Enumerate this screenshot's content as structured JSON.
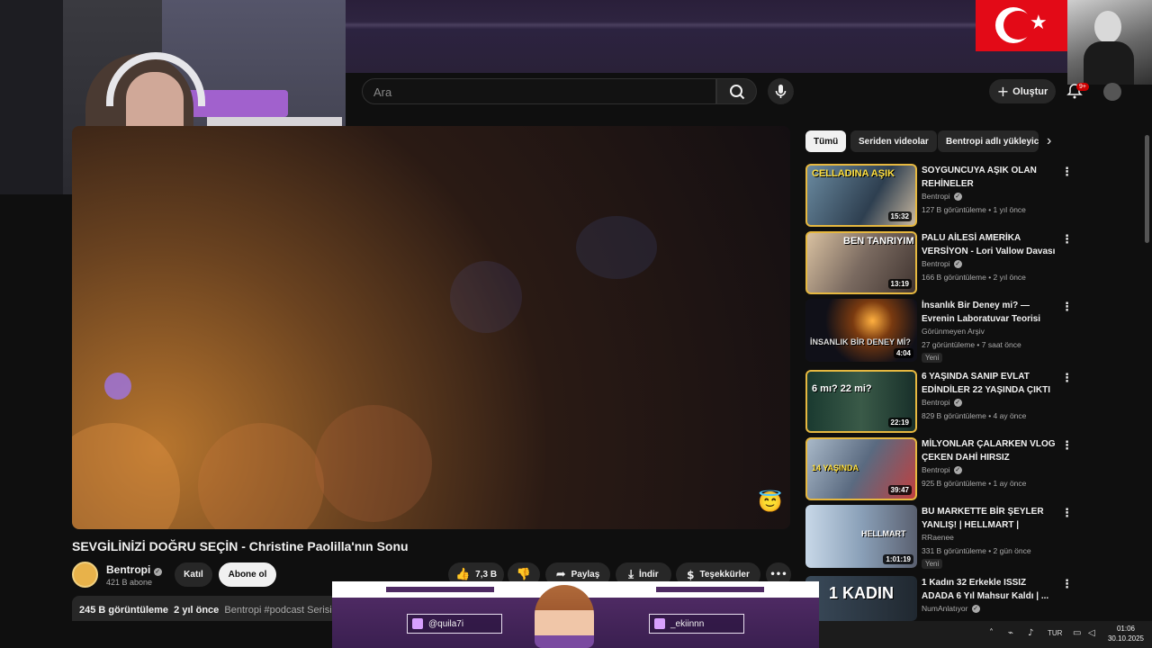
{
  "header": {
    "search_placeholder": "Ara",
    "create_label": "Oluştur",
    "notif_count": "9+"
  },
  "video": {
    "title": "SEVGİLİNİZİ DOĞRU SEÇİN - Christine Paolilla'nın Sonu",
    "channel": "Bentropi",
    "subs": "421 B abone",
    "join_label": "Katıl",
    "subscribe_label": "Abone ol",
    "likes": "7,3 B",
    "share_label": "Paylaş",
    "download_label": "İndir",
    "thanks_label": "Teşekkürler",
    "views": "245 B görüntüleme",
    "age": "2 yıl önce",
    "desc_channel": "Bentropi",
    "hashtag": "#podcast Serisi"
  },
  "chips": [
    "Tümü",
    "Seriden videolar",
    "Bentropi adlı yükleyici"
  ],
  "recs": [
    {
      "title": "SOYGUNCUYA AŞIK OLAN REHİNELER",
      "channel": "Bentropi",
      "meta": "127 B görüntüleme • 1 yıl önce",
      "duration": "15:32",
      "thumb_text": "CELLADINA AŞIK",
      "badge": ""
    },
    {
      "title": "PALU AİLESİ AMERİKA VERSİYON - Lori Vallow Davası",
      "channel": "Bentropi",
      "meta": "166 B görüntüleme • 2 yıl önce",
      "duration": "13:19",
      "thumb_text": "BEN TANRIYIM",
      "badge": ""
    },
    {
      "title": "İnsanlık Bir Deney mi? — Evrenin Laboratuvar Teorisi",
      "channel": "Görünmeyen Arşiv",
      "meta": "27 görüntüleme • 7 saat önce",
      "duration": "4:04",
      "thumb_text": "İNSANLIK BİR DENEY Mİ?",
      "badge": "Yeni"
    },
    {
      "title": "6 YAŞINDA SANIP EVLAT EDİNDİLER 22 YAŞINDA ÇIKTI",
      "channel": "Bentropi",
      "meta": "829 B görüntüleme • 4 ay önce",
      "duration": "22:19",
      "thumb_text": "6 mı?  22 mi?",
      "badge": ""
    },
    {
      "title": "MİLYONLAR ÇALARKEN VLOG ÇEKEN DAHİ HIRSIZ",
      "channel": "Bentropi",
      "meta": "925 B görüntüleme • 1 ay önce",
      "duration": "39:47",
      "thumb_text": "14 YAŞINDA",
      "badge": ""
    },
    {
      "title": "BU MARKETTE BİR ŞEYLER YANLIŞ! | HELLMART |",
      "channel": "RRaenee",
      "meta": "331 B görüntüleme • 2 gün önce",
      "duration": "1:01:19",
      "thumb_text": "HELLMART",
      "badge": "Yeni"
    },
    {
      "title": "1 Kadın 32 Erkekle ISSIZ ADADA 6 Yıl Mahsur Kaldı | ...",
      "channel": "NumAnlatıyor",
      "meta": "",
      "duration": "",
      "thumb_text": "1 KADIN",
      "badge": ""
    }
  ],
  "overlay": {
    "handle_left": "@quila7i",
    "handle_right": "_ekiinnn"
  },
  "taskbar": {
    "lang": "TUR",
    "time": "01:06",
    "date": "30.10.2025"
  }
}
